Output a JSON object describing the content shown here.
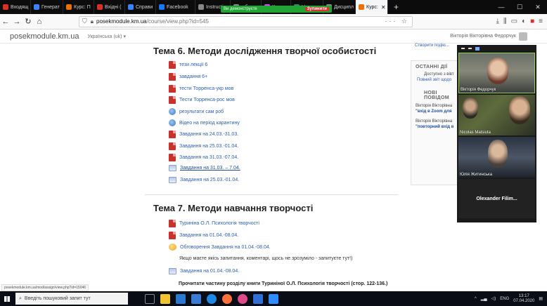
{
  "browser": {
    "tabs": [
      {
        "label": "Входящ",
        "color": "#d93025"
      },
      {
        "label": "Генерат",
        "color": "#3b82f6"
      },
      {
        "label": "Курс: П",
        "color": "#e8710a"
      },
      {
        "label": "Вхідні (",
        "color": "#d93025"
      },
      {
        "label": "Справи",
        "color": "#3b82f6"
      },
      {
        "label": "Facebook",
        "color": "#1877f2"
      },
      {
        "label": "Instruction",
        "color": "#888888"
      },
      {
        "label": "у б",
        "color": "#888888"
      },
      {
        "label": "Классн",
        "color": "#d946ef"
      },
      {
        "label": "Написат",
        "color": "#2e8b57"
      },
      {
        "label": "Дисципл",
        "color": "#888888"
      },
      {
        "label": "Курс:",
        "color": "#e8710a",
        "active": true
      }
    ],
    "zoom_share_bar": {
      "label": "Ви демонструєте",
      "stop_label": "Зупинити"
    },
    "url": {
      "host": "posekmodule.km.ua",
      "path": "/course/view.php?id=545"
    },
    "window_controls": [
      "—",
      "☐",
      "✕"
    ]
  },
  "site": {
    "brand": "posekmodule.km.ua",
    "language": "Українська (uk) ▾",
    "user": "Вікторія Вікторівна Федорчук"
  },
  "topic6": {
    "title": "Тема 6. Методи дослідження творчої особистості",
    "activities": [
      {
        "icon": "pdf",
        "label": "тези лекції 6"
      },
      {
        "icon": "pdf",
        "label": "завдання 6+"
      },
      {
        "icon": "pdf",
        "label": "тести Торренса-укр мов"
      },
      {
        "icon": "pdf",
        "label": "Тести Торренса-рос мов"
      },
      {
        "icon": "url",
        "label": "результати сам роб"
      },
      {
        "icon": "url",
        "label": "Відео на період карантину"
      },
      {
        "icon": "pdf",
        "label": "Завдання на 24.03.-31.03."
      },
      {
        "icon": "pdf",
        "label": "Завдання на 25.03.-01.04."
      },
      {
        "icon": "pdf",
        "label": "Завдання на 31.03.-07.04."
      },
      {
        "icon": "assign",
        "label": "Завдання на 31.03. – 7.04.",
        "underlined": true
      },
      {
        "icon": "assign",
        "label": "Завдання на 25.03.-01.04."
      }
    ]
  },
  "topic7": {
    "title": "Тема 7. Методи навчання творчості",
    "activities": [
      {
        "icon": "pdf",
        "label": "Туриніна О.Л. Психологія творчості"
      },
      {
        "icon": "pdf",
        "label": "Завдання на 01.04.-08.04."
      },
      {
        "icon": "forum",
        "label": "Обговорення Завдання на 01.04.-08.04."
      },
      {
        "icon": "none",
        "label": "Якщо маєте якісь запитання, коментарі, щось не зрозуміло - запитуєте тут!)"
      },
      {
        "icon": "assign",
        "label": "Завдання на 01.04.-08.04."
      },
      {
        "icon": "none",
        "label": "Прочитати частину розділу книги Туриніної О.Л. Психологія творчості (стор. 122-136.)",
        "bold": true
      }
    ]
  },
  "sidebar": {
    "top_link": "Створити подію...",
    "recent": {
      "title": "ОСТАННІ ДІЇ",
      "line1": "Доступно з вівт",
      "link": "Повний звіт щодо"
    },
    "news": {
      "title": "НОВІ ПОВІДОМ",
      "items": [
        {
          "author": "Вікторія Вікторівна",
          "subject": "\"вхід в Zoom для"
        },
        {
          "author": "Вікторія Вікторівна",
          "subject": "\"повторний вхід в"
        }
      ]
    }
  },
  "zoom_panel": {
    "participants": [
      "Вікторія Федорчук",
      "Nicolas Matsiuta",
      "Юлія Житинська",
      "Olexander  Filim..."
    ]
  },
  "status_url": "posekmodule.km.ua/mod/assign/view.php?id=15046",
  "taskbar": {
    "search_placeholder": "Введіть пошуковий запит тут",
    "language": "ENG",
    "time": "13:17",
    "date": "07.04.2020"
  }
}
